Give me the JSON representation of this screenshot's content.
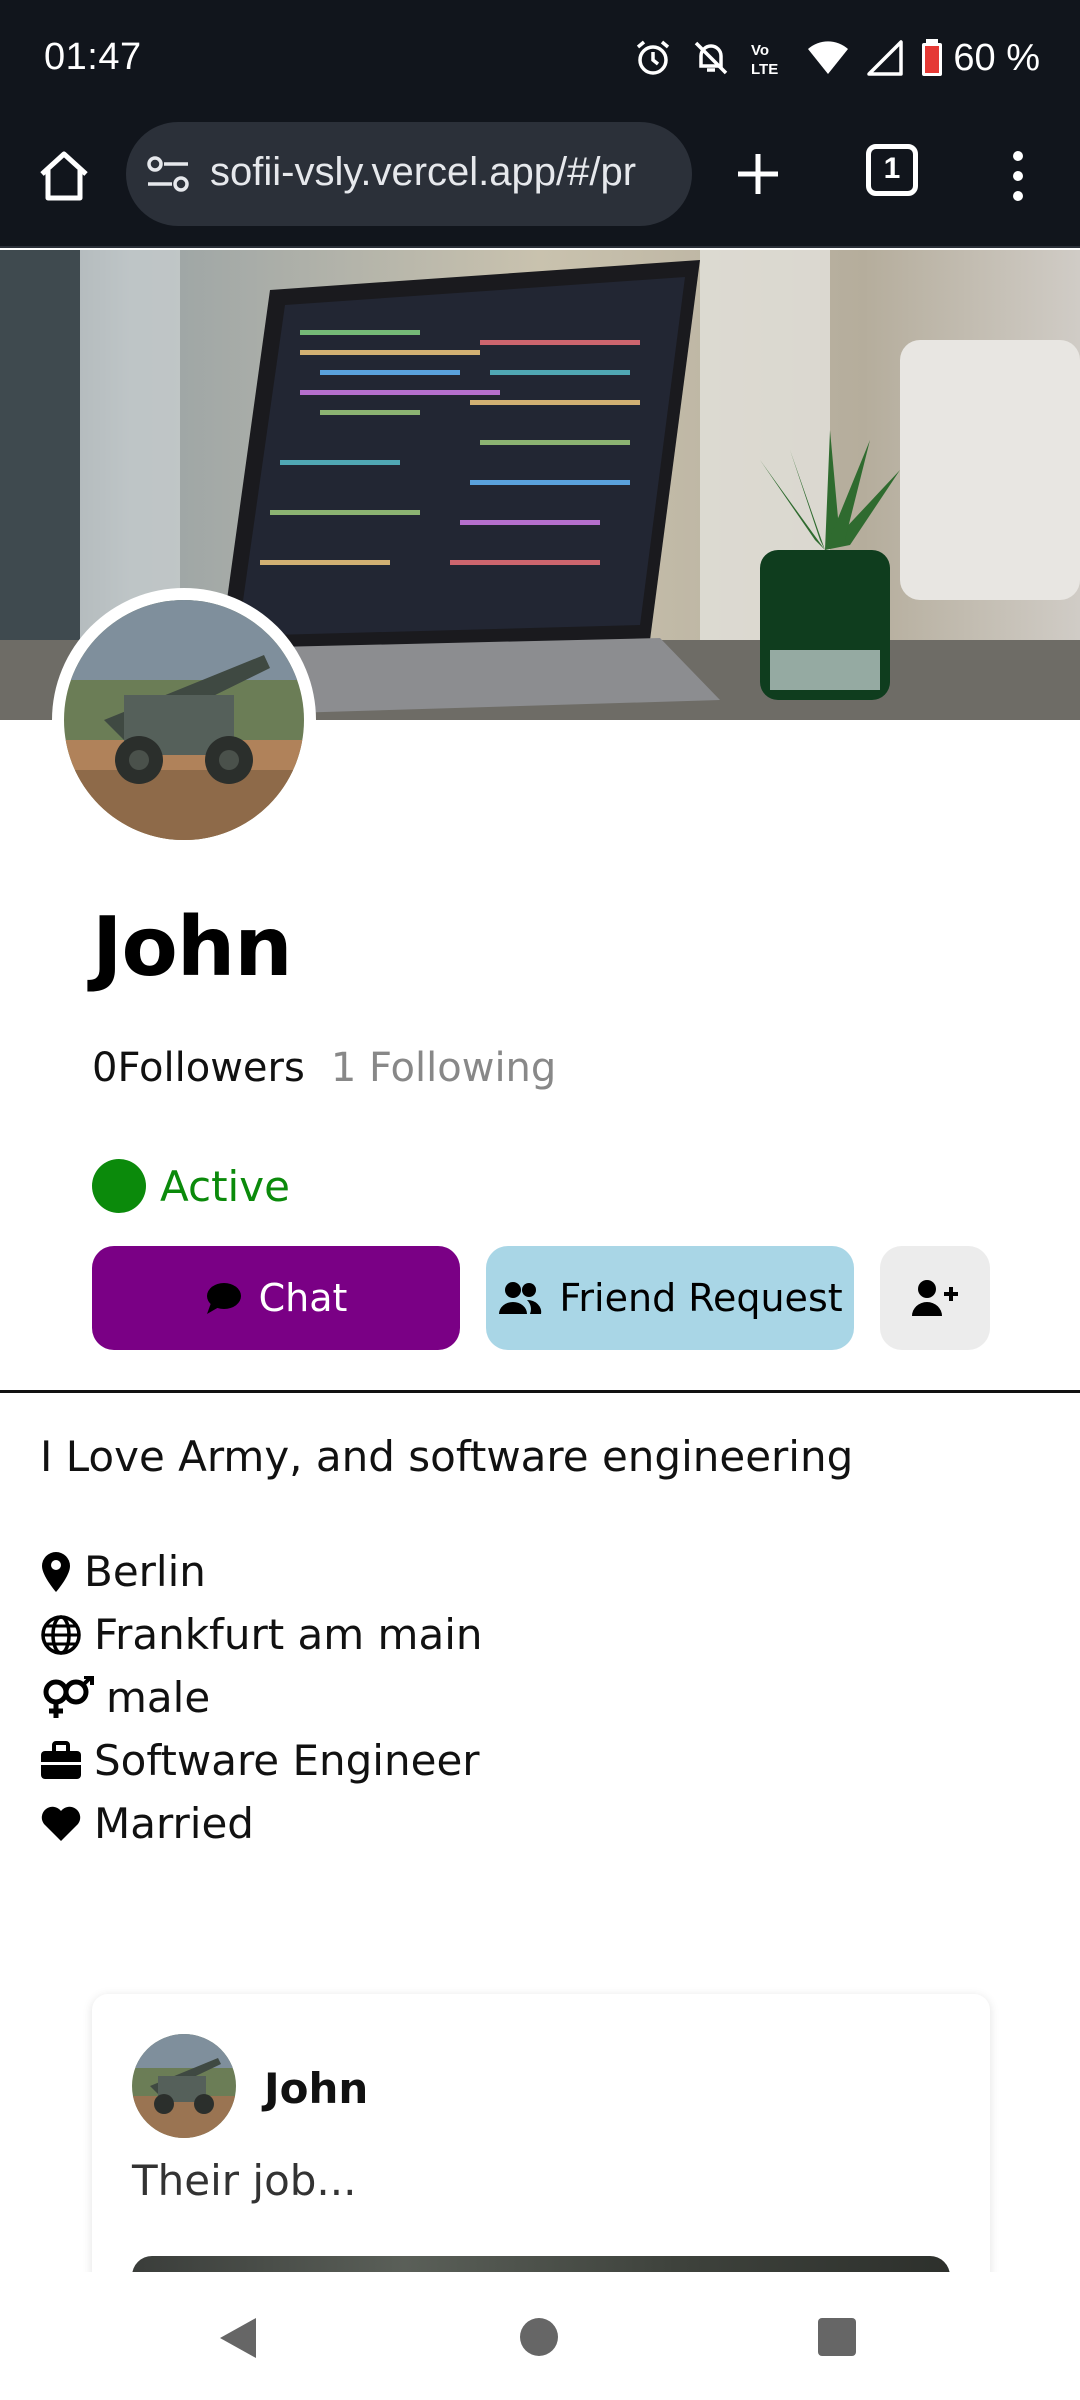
{
  "status_bar": {
    "time": "01:47",
    "battery_level": "60 %",
    "icons": [
      "alarm-icon",
      "notifications-off-icon",
      "volte-icon",
      "wifi-icon",
      "signal-icon",
      "battery-icon"
    ]
  },
  "browser": {
    "url": "sofii-vsly.vercel.app/#/pr",
    "tab_count": "1",
    "icons": [
      "home-icon",
      "site-settings-icon",
      "new-tab-icon",
      "tabs-icon",
      "more-menu-icon"
    ]
  },
  "profile": {
    "name": "John",
    "followers": "0Followers",
    "following": "1 Following",
    "status": "Active",
    "status_color": "#0b8a0b",
    "buttons": {
      "chat": "Chat",
      "friend_request": "Friend Request"
    },
    "bio": "I Love Army, and software engineering",
    "info": [
      {
        "icon": "location-pin-icon",
        "text": "Berlin"
      },
      {
        "icon": "globe-icon",
        "text": "Frankfurt am main"
      },
      {
        "icon": "gender-icon",
        "text": "male"
      },
      {
        "icon": "briefcase-icon",
        "text": "Software Engineer"
      },
      {
        "icon": "heart-icon",
        "text": "Married"
      }
    ]
  },
  "post": {
    "author": "John",
    "text": "Their job..."
  },
  "colors": {
    "chat_button": "#7a0085",
    "friend_button": "#a9d6e6",
    "add_button": "#ececec",
    "top_bar": "#11151c"
  },
  "nav_bar": {
    "icons": [
      "back-icon",
      "home-circle-icon",
      "recents-icon"
    ]
  }
}
